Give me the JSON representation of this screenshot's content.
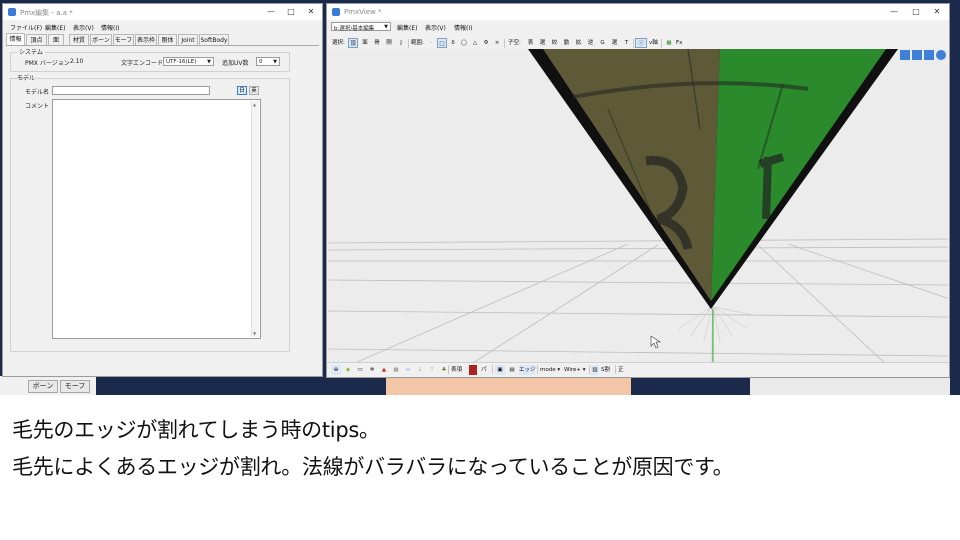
{
  "pmx_editor": {
    "title": "Pmx編集 - a.a *",
    "menu": [
      "ファイル(F)",
      "編集(E)",
      "表示(V)",
      "情報(I)"
    ],
    "tabs": [
      "情報",
      "頂点",
      "面",
      "材質",
      "ボーン",
      "モーフ",
      "表示枠",
      "剛体",
      "Joint",
      "SoftBody"
    ],
    "system_label": "システム",
    "pmx_version_label": "PMX バージョン",
    "pmx_version_value": "2.10",
    "encoding_label": "文字エンコード",
    "encoding_value": "UTF-16(LE)",
    "add_uv_label": "追加UV数",
    "add_uv_value": "0",
    "model_label": "モデル",
    "model_name_label": "モデル名",
    "lang_jp": "日",
    "lang_en": "英",
    "comment_label": "コメント"
  },
  "background_window": {
    "tabs": [
      "ボーン",
      "モーフ"
    ]
  },
  "pmx_view": {
    "title": "PmxView *",
    "menu": [
      "b:選択/基本編集",
      "編集(E)",
      "表示(V)",
      "情報(I)"
    ],
    "toolbar": {
      "select_label": "選択:",
      "select_items": [
        "頂",
        "面",
        "骨",
        "剛",
        "J"
      ],
      "range_label": "範囲:",
      "range_items": [
        "·",
        "□",
        "δ",
        "◯",
        "△",
        "Φ",
        "×"
      ],
      "edit_label": "子空:",
      "edit_items": [
        "表",
        "選",
        "絞",
        "動",
        "拡",
        "逆",
        "G",
        "選",
        "T"
      ],
      "v_axis": "v軸",
      "fx": "Fx"
    },
    "bottombar": {
      "items_left": [
        "表項",
        "パ"
      ],
      "edge_label": "エッジ",
      "mode_label": "mode",
      "wire_label": "Wire+",
      "s_label": "S割",
      "front_label": "正"
    },
    "colors": {
      "left_face": "#5e5a38",
      "right_face": "#2a8a2c",
      "edge": "#101010",
      "viewport": "#ececec"
    }
  },
  "caption": {
    "line1": "毛先のエッジが割れてしまう時のtips。",
    "line2": "毛先によくあるエッジが割れ。法線がバラバラになっていることが原因です。"
  }
}
